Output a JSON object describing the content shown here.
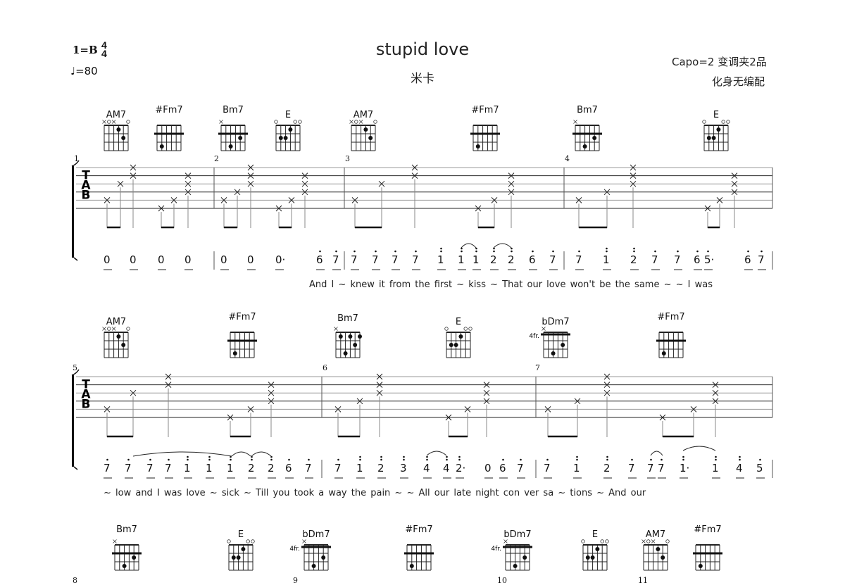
{
  "header": {
    "title": "stupid love",
    "artist": "米卡",
    "key": "1=B",
    "time_signature": {
      "top": "4",
      "bottom": "4"
    },
    "tempo": "♩=80",
    "capo": "Capo=2 变调夹2品",
    "arranger": "化身无编配"
  },
  "systems": [
    {
      "chords": [
        {
          "name": "AM7"
        },
        {
          "name": "#Fm7"
        },
        {
          "name": "Bm7"
        },
        {
          "name": "E"
        },
        {
          "name": "AM7"
        },
        {
          "name": "#Fm7"
        },
        {
          "name": "Bm7"
        },
        {
          "name": "E"
        }
      ],
      "measure_numbers": [
        "1",
        "2",
        "3",
        "4"
      ],
      "notation": [
        [
          "0",
          "0",
          "0",
          "0"
        ],
        [
          "0",
          "0",
          "0·",
          "6",
          "7"
        ],
        [
          "7",
          "7",
          "7",
          "7",
          "1",
          "1",
          "1",
          "2",
          "2",
          "6",
          "7"
        ],
        [
          "7",
          "1",
          "2",
          "7",
          "7",
          "6",
          "5·",
          "6",
          "7"
        ]
      ],
      "lyrics": "And I  ~ knew it from  the first ~ kiss ~ That our love won't be the same ~ ~        I was"
    },
    {
      "chords": [
        {
          "name": "AM7"
        },
        {
          "name": "#Fm7"
        },
        {
          "name": "Bm7"
        },
        {
          "name": "E"
        },
        {
          "name": "bDm7",
          "fret": "4fr."
        },
        {
          "name": "#Fm7"
        }
      ],
      "measure_numbers": [
        "5",
        "6",
        "7"
      ],
      "notation": [
        [
          "7",
          "7",
          "7",
          "7",
          "1",
          "1",
          "1",
          "2",
          "2",
          "6",
          "7"
        ],
        [
          "7",
          "1",
          "2",
          "3",
          "4",
          "4",
          "2·",
          "0",
          "6",
          "7"
        ],
        [
          "7",
          "1",
          "2",
          "7",
          "7",
          "7",
          "1·",
          "1",
          "4",
          "5"
        ]
      ],
      "lyrics": "~ low  and I  was love ~  sick  ~  Till you took  a  way  the pain ~ ~        All our late  night  con  ver sa ~ tions    ~  And our"
    },
    {
      "chords": [
        {
          "name": "Bm7"
        },
        {
          "name": "E"
        },
        {
          "name": "bDm7",
          "fret": "4fr."
        },
        {
          "name": "#Fm7"
        },
        {
          "name": "bDm7",
          "fret": "4fr."
        },
        {
          "name": "E"
        },
        {
          "name": "AM7"
        },
        {
          "name": "#Fm7"
        }
      ],
      "measure_numbers": [
        "8",
        "9",
        "10",
        "11"
      ]
    }
  ],
  "tab_clef": [
    "T",
    "A",
    "B"
  ]
}
